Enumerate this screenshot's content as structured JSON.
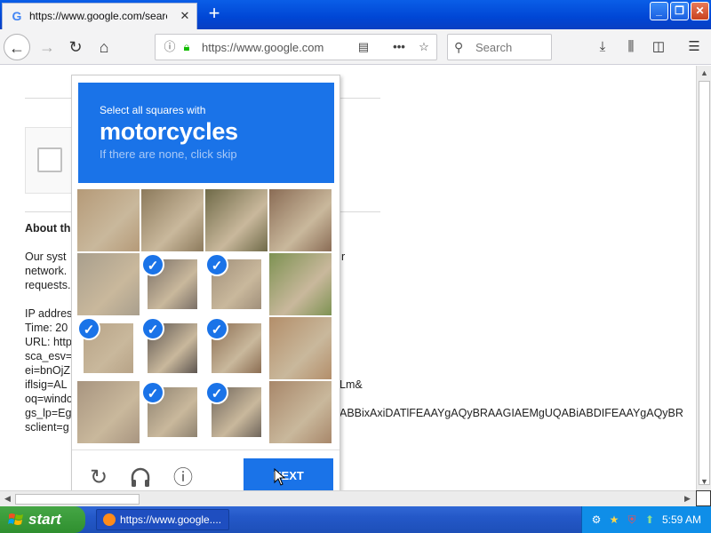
{
  "browser": {
    "tab_title": "https://www.google.com/search?",
    "tab_favicon": "G",
    "new_tab_label": "+",
    "url": "https://www.google.com",
    "search_placeholder": "Search",
    "window_buttons": {
      "minimize": "_",
      "maximize": "❐",
      "close": "✕"
    },
    "nav_icons": [
      "back-arrow-icon",
      "forward-arrow-icon",
      "reload-icon",
      "home-icon"
    ],
    "toolbar_icons": [
      "download-icon",
      "library-icon",
      "sidebar-icon",
      "menu-icon"
    ]
  },
  "page": {
    "heading": "About th",
    "para1": [
      "Our syst",
      "network.",
      "requests."
    ],
    "para1_right": "r",
    "details": [
      "IP addres",
      "Time: 20",
      "URL: http",
      "sca_esv=",
      "ei=bnOjZ",
      "iflsig=AL",
      "oq=windo",
      "gs_lp=Eg",
      "sclient=g"
    ],
    "details_right_1": "Lm&",
    "details_right_2": "ABBixAxiDATlFEAAYgAQyBRAAGIAEMgUQABiABDIFEAAYgAQyBR"
  },
  "captcha": {
    "prompt_small": "Select all squares with",
    "prompt_target": "motorcycles",
    "prompt_hint": "If there are none, click skip",
    "next_label": "NEXT",
    "header_color": "#1a73e8",
    "selected_tiles": [
      [
        1,
        1
      ],
      [
        1,
        2
      ],
      [
        2,
        0
      ],
      [
        2,
        1
      ],
      [
        2,
        2
      ],
      [
        3,
        1
      ],
      [
        3,
        2
      ]
    ],
    "footer_icons": [
      "reload-icon",
      "headphones-icon",
      "info-icon"
    ]
  },
  "taskbar": {
    "start_label": "start",
    "task_label": "https://www.google....",
    "clock": "5:59 AM"
  }
}
